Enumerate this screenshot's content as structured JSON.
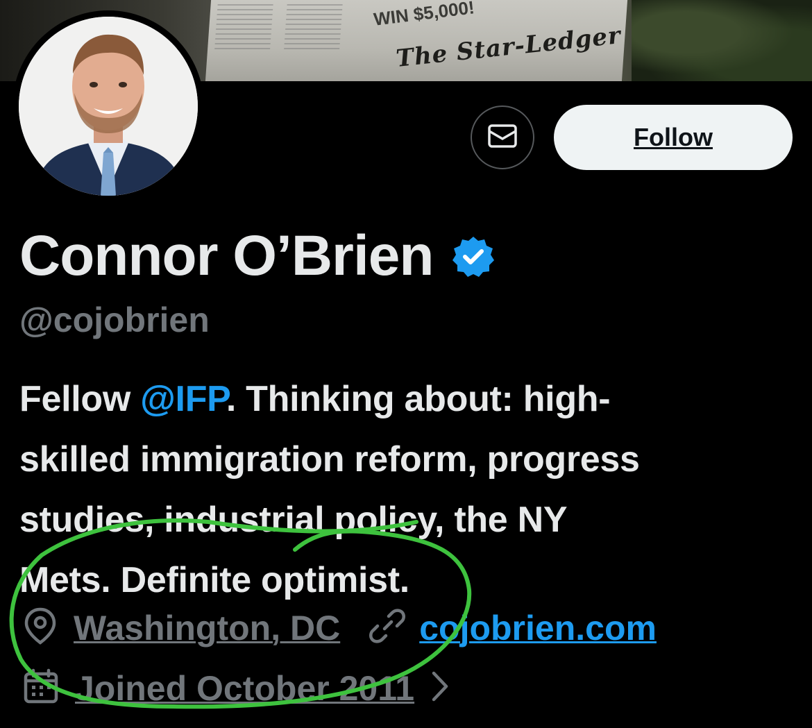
{
  "banner": {
    "newspaper_title": "The Star-Ledger",
    "newspaper_headline": "WIN $5,000!"
  },
  "profile": {
    "display_name": "Connor O’Brien",
    "handle": "@cojobrien",
    "verified": true,
    "bio_prefix": "Fellow ",
    "bio_mention": "@IFP",
    "bio_rest_line1": ". Thinking about: high-",
    "bio_line2": "skilled immigration reform, progress",
    "bio_line3": "studies, industrial policy, the NY",
    "bio_line4": "Mets. Definite optimist.",
    "location": "Washington, DC",
    "website": "cojobrien.com",
    "joined": "Joined October 2011"
  },
  "actions": {
    "follow_label": "Follow",
    "message_icon": "envelope-icon"
  },
  "colors": {
    "accent": "#1d9bf0",
    "muted": "#71767b",
    "annotation": "#3ec23e"
  }
}
